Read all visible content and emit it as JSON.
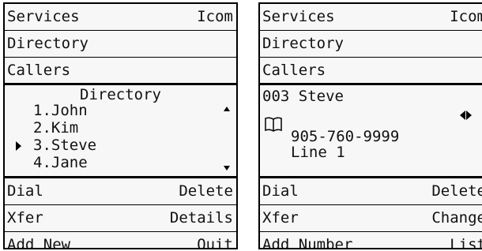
{
  "left": {
    "menu": {
      "services": "Services",
      "icom": "Icom",
      "directory": "Directory",
      "callers": "Callers"
    },
    "directory": {
      "title": "Directory",
      "entries": [
        "1.John",
        "2.Kim",
        "3.Steve",
        "4.Jane"
      ],
      "selected_index": 2
    },
    "softkeys": {
      "dial": "Dial",
      "delete": "Delete",
      "xfer": "Xfer",
      "details": "Details",
      "add_new": "Add New",
      "quit": "Quit"
    }
  },
  "right": {
    "menu": {
      "services": "Services",
      "icom": "Icom",
      "directory": "Directory",
      "callers": "Callers"
    },
    "entry": {
      "header": "003 Steve",
      "number": "905-760-9999",
      "line": "Line 1",
      "icon": "directory-book-icon"
    },
    "softkeys": {
      "dial": "Dial",
      "delete": "Delete",
      "xfer": "Xfer",
      "change": "Change",
      "add_number": "Add Number",
      "list": "List"
    }
  }
}
